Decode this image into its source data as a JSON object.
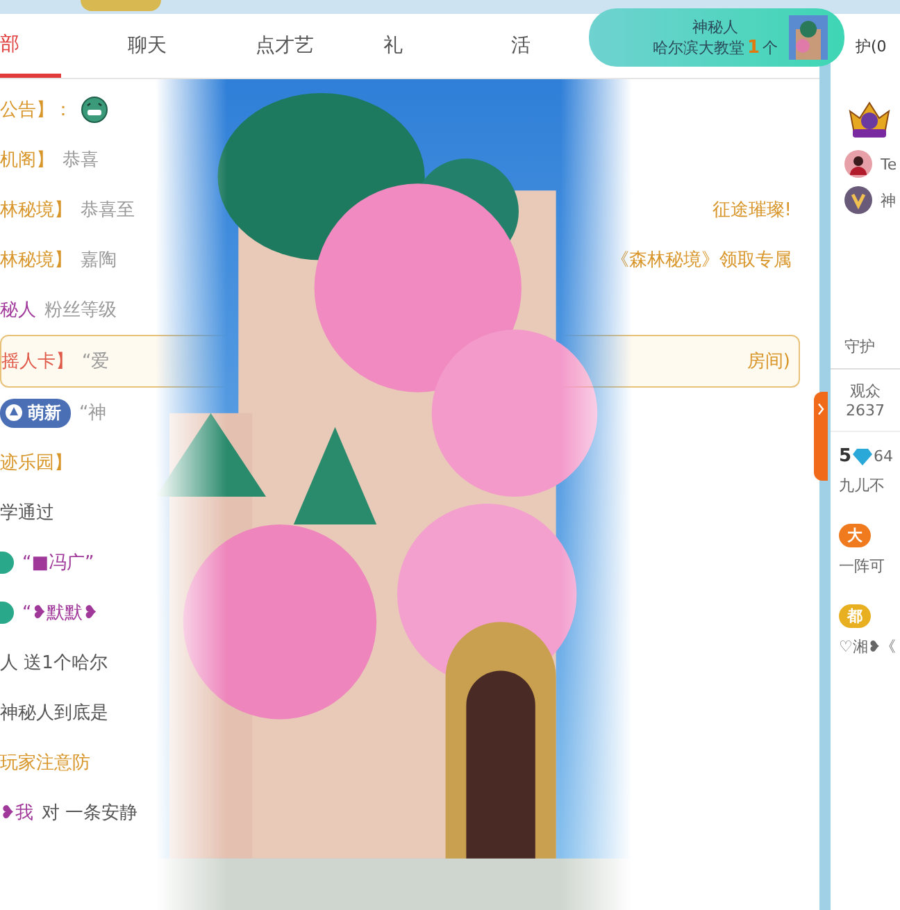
{
  "tabs": [
    {
      "label": "部",
      "selected": true
    },
    {
      "label": "聊天",
      "selected": false
    },
    {
      "label": "点才艺",
      "selected": false
    },
    {
      "label": "礼",
      "selected": false
    },
    {
      "label": "活",
      "selected": false
    }
  ],
  "chat": [
    {
      "parts": [
        {
          "kind": "system",
          "text": "公告】："
        },
        {
          "kind": "emoji"
        }
      ]
    },
    {
      "parts": [
        {
          "kind": "system",
          "text": "机阁】"
        },
        {
          "kind": "plain",
          "text": "恭喜"
        }
      ]
    },
    {
      "parts": [
        {
          "kind": "system",
          "text": "林秘境】"
        },
        {
          "kind": "plain",
          "text": "恭喜至"
        }
      ],
      "right": "征途璀璨!"
    },
    {
      "parts": [
        {
          "kind": "system",
          "text": "林秘境】"
        },
        {
          "kind": "plain",
          "text": "嘉陶"
        }
      ],
      "right": "《森林秘境》领取专属"
    },
    {
      "parts": [
        {
          "kind": "name",
          "text": "秘人"
        },
        {
          "kind": "plain",
          "text": "粉丝等级"
        }
      ]
    },
    {
      "boxed": true,
      "parts": [
        {
          "kind": "alert",
          "text": "摇人卡】"
        },
        {
          "kind": "plain",
          "text": "“爱"
        }
      ],
      "right": "房间)"
    },
    {
      "parts": [
        {
          "kind": "badge",
          "text": "萌新"
        },
        {
          "kind": "plain",
          "text": "“神"
        }
      ]
    },
    {
      "parts": [
        {
          "kind": "system",
          "text": "迹乐园】"
        }
      ]
    },
    {
      "parts": [
        {
          "kind": "dark",
          "text": "学通过"
        }
      ]
    },
    {
      "parts": [
        {
          "kind": "level"
        },
        {
          "kind": "name",
          "text": "“■冯广”"
        }
      ]
    },
    {
      "parts": [
        {
          "kind": "level"
        },
        {
          "kind": "name",
          "text": "“❥默默❥"
        }
      ]
    },
    {
      "parts": [
        {
          "kind": "dark",
          "text": "人 送1个哈尔"
        }
      ]
    },
    {
      "parts": [
        {
          "kind": "dark",
          "text": "神秘人到底是"
        }
      ]
    },
    {
      "parts": [
        {
          "kind": "system",
          "text": "玩家注意防"
        }
      ]
    },
    {
      "parts": [
        {
          "kind": "name",
          "text": "❥我"
        },
        {
          "kind": "dark",
          "text": "对 一条安静"
        }
      ]
    }
  ],
  "toast": {
    "sender": "神秘人",
    "gift": "哈尔滨大教堂",
    "count": "1",
    "unit": "个"
  },
  "side": {
    "tab": "护(0",
    "guards": [
      {
        "name": "Te",
        "kind": "person"
      },
      {
        "name": "神",
        "kind": "emblem"
      }
    ],
    "guard_label": "守护",
    "audience_label": "观众",
    "audience_count": "2637",
    "messages": [
      {
        "rank": "5",
        "text": "64",
        "line": "九儿不"
      },
      {
        "badge": "大",
        "color": "#f07a1e",
        "line": "一阵可"
      },
      {
        "badge": "都",
        "color": "#e8b020",
        "line": "♡湘❥《"
      }
    ]
  }
}
